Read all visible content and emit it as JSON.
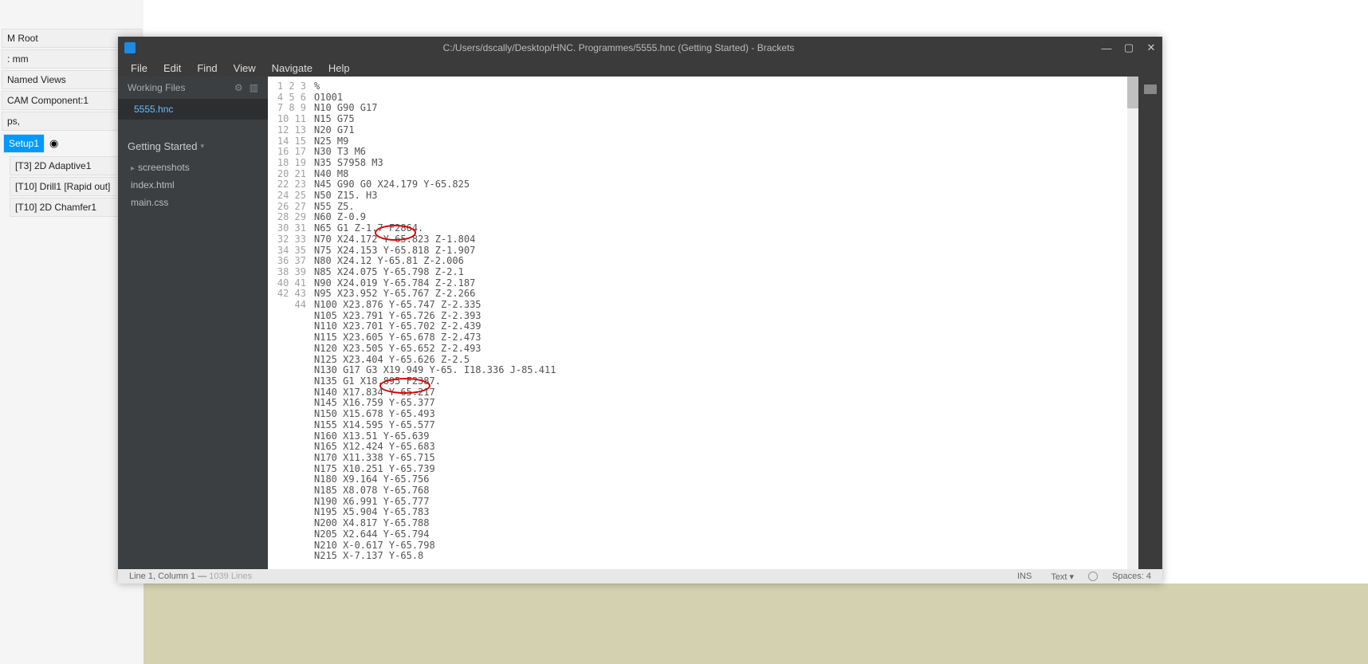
{
  "behind_tree": {
    "root": "M Root",
    "units": ": mm",
    "named_views": "Named Views",
    "cam_comp": "CAM Component:1",
    "ps": "ps,",
    "setup": "Setup1",
    "op1": "[T3] 2D Adaptive1",
    "op2": "[T10] Drill1 [Rapid out]",
    "op3": "[T10] 2D Chamfer1"
  },
  "brackets": {
    "title": "C:/Users/dscally/Desktop/HNC. Programmes/5555.hnc (Getting Started) - Brackets",
    "menu": {
      "file": "File",
      "edit": "Edit",
      "find": "Find",
      "view": "View",
      "navigate": "Navigate",
      "help": "Help"
    },
    "sidebar": {
      "working_files": "Working Files",
      "open_file": "5555.hnc",
      "project_name": "Getting Started",
      "items": {
        "screenshots": "screenshots",
        "index": "index.html",
        "main": "main.css"
      }
    },
    "code_lines": [
      "%",
      "O1001",
      "N10 G90 G17",
      "N15 G75",
      "N20 G71",
      "N25 M9",
      "N30 T3 M6",
      "N35 S7958 M3",
      "N40 M8",
      "N45 G90 G0 X24.179 Y-65.825",
      "N50 Z15. H3",
      "N55 Z5.",
      "N60 Z-0.9",
      "N65 G1 Z-1.7 F2864.",
      "N70 X24.172 Y-65.823 Z-1.804",
      "N75 X24.153 Y-65.818 Z-1.907",
      "N80 X24.12 Y-65.81 Z-2.006",
      "N85 X24.075 Y-65.798 Z-2.1",
      "N90 X24.019 Y-65.784 Z-2.187",
      "N95 X23.952 Y-65.767 Z-2.266",
      "N100 X23.876 Y-65.747 Z-2.335",
      "N105 X23.791 Y-65.726 Z-2.393",
      "N110 X23.701 Y-65.702 Z-2.439",
      "N115 X23.605 Y-65.678 Z-2.473",
      "N120 X23.505 Y-65.652 Z-2.493",
      "N125 X23.404 Y-65.626 Z-2.5",
      "N130 G17 G3 X19.949 Y-65. I18.336 J-85.411",
      "N135 G1 X18.895 F2387.",
      "N140 X17.834 Y-65.217",
      "N145 X16.759 Y-65.377",
      "N150 X15.678 Y-65.493",
      "N155 X14.595 Y-65.577",
      "N160 X13.51 Y-65.639",
      "N165 X12.424 Y-65.683",
      "N170 X11.338 Y-65.715",
      "N175 X10.251 Y-65.739",
      "N180 X9.164 Y-65.756",
      "N185 X8.078 Y-65.768",
      "N190 X6.991 Y-65.777",
      "N195 X5.904 Y-65.783",
      "N200 X4.817 Y-65.788",
      "N205 X2.644 Y-65.794",
      "N210 X-0.617 Y-65.798",
      "N215 X-7.137 Y-65.8"
    ],
    "status": {
      "cursor": "Line 1, Column 1",
      "lines": "1039 Lines",
      "ins": "INS",
      "lang": "Text",
      "spaces": "Spaces: 4"
    }
  }
}
